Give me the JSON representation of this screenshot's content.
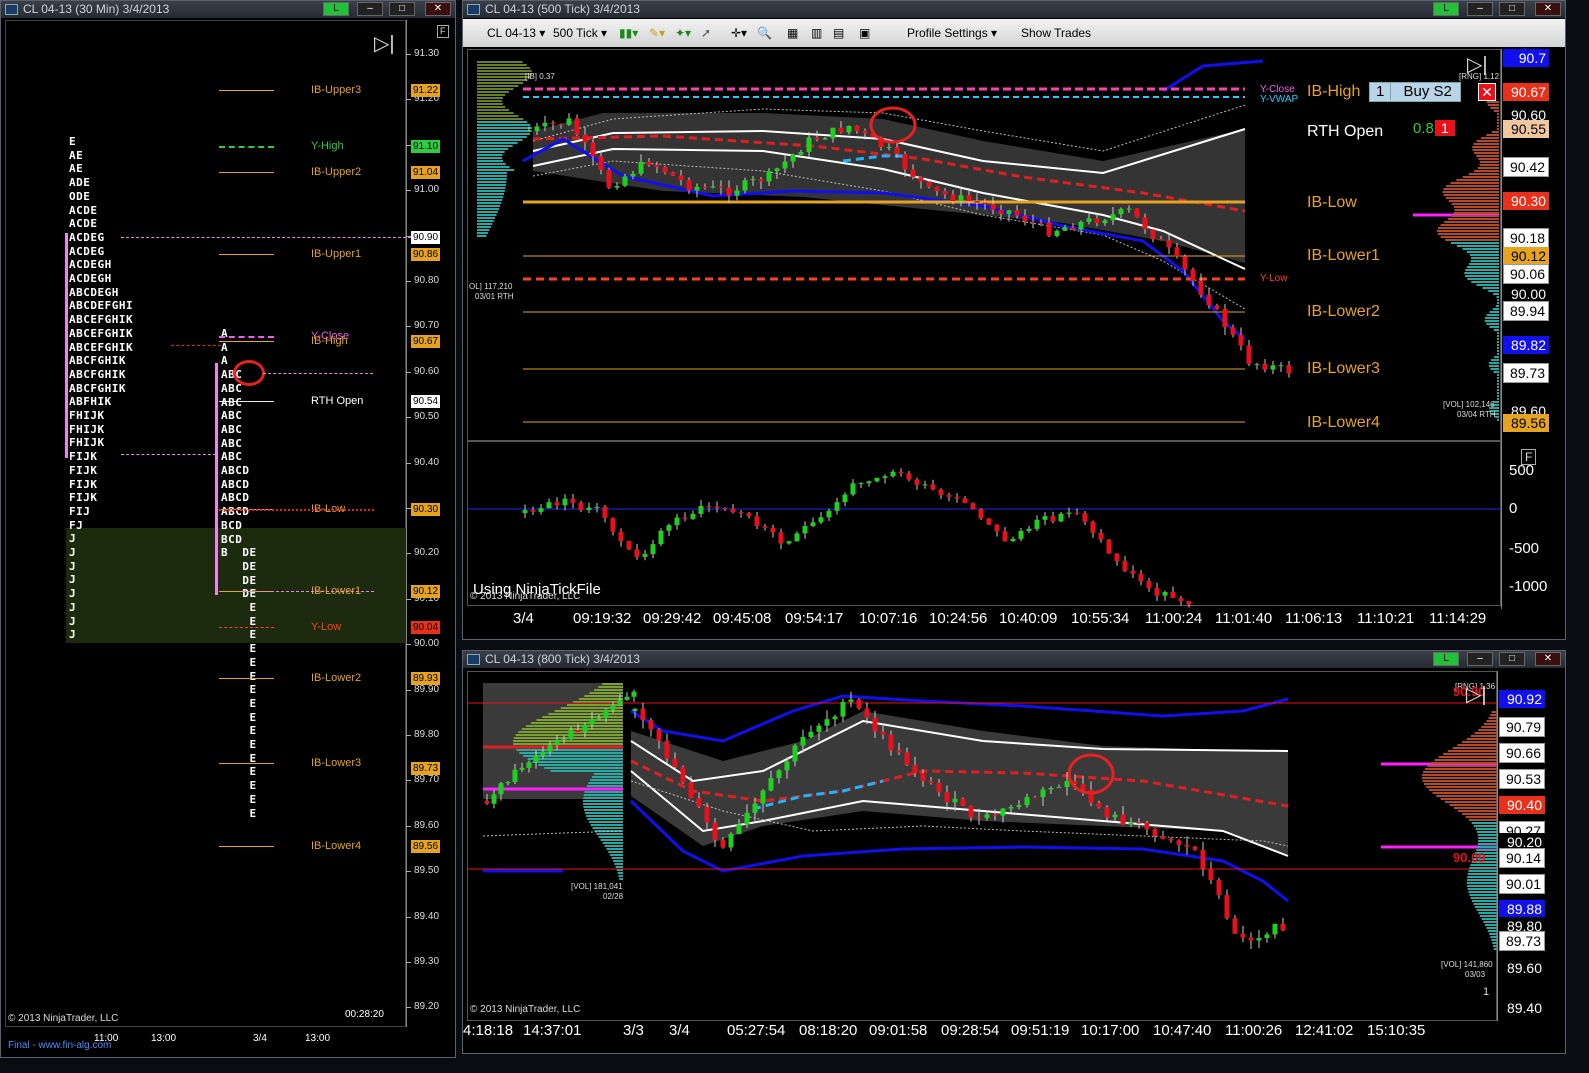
{
  "left": {
    "title": "CL 04-13 (30 Min)  3/4/2013",
    "prices": [
      "91.30",
      "91.20",
      "91.10",
      "91.00",
      "90.90",
      "90.80",
      "90.70",
      "90.60",
      "90.50",
      "90.40",
      "90.30",
      "90.20",
      "90.10",
      "90.00",
      "89.90",
      "89.80",
      "89.70",
      "89.60",
      "89.50",
      "89.40",
      "89.30",
      "89.20"
    ],
    "tags": [
      {
        "label": "91.22",
        "color": "#e5a320"
      },
      {
        "label": "91.10",
        "color": "#2ecc40"
      },
      {
        "label": "91.04",
        "color": "#e5a320"
      },
      {
        "label": "90.90",
        "color": "#ffffff"
      },
      {
        "label": "90.86",
        "color": "#e5a320"
      },
      {
        "label": "90.67",
        "color": "#e5a320"
      },
      {
        "label": "90.54",
        "color": "#ffffff"
      },
      {
        "label": "90.30",
        "color": "#e5a320"
      },
      {
        "label": "90.12",
        "color": "#e5a320"
      },
      {
        "label": "90.04",
        "color": "#e8301a"
      },
      {
        "label": "89.93",
        "color": "#e5a320"
      },
      {
        "label": "89.73",
        "color": "#e5a320"
      },
      {
        "label": "89.56",
        "color": "#e5a320"
      }
    ],
    "levels": [
      "IB-Upper3",
      "Y-High",
      "IB-Upper2",
      "IB-Upper1",
      "Y-Close",
      "IB-High",
      "RTH Open",
      "IB-Low",
      "IB-Lower1",
      "Y-Low",
      "IB-Lower2",
      "IB-Lower3",
      "IB-Lower4"
    ],
    "profile1": [
      "E",
      "AE",
      "AE",
      "ADE",
      "ODE",
      "ACDE",
      "ACDE",
      "ACDEG",
      "ACDEG",
      "ACDEGH",
      "ACDEGH",
      "ABCDEGH",
      "ABCDEFGHI",
      "ABCEFGHIK",
      "ABCEFGHIK",
      "ABCEFGHIK",
      "ABCFGHIK",
      "ABCFGHIK",
      "ABCFGHIK",
      "ABFHIK",
      "FHIJK",
      "FHIJK",
      "FHIJK",
      "FIJK",
      "FIJK",
      "FIJK",
      "FIJK",
      "FIJ",
      "FJ",
      "J",
      "J",
      "J",
      "J",
      "J",
      "J",
      "J",
      "J"
    ],
    "profile2": [
      "A",
      "A",
      "A",
      "ABC",
      "ABC",
      "ABC",
      "ABC",
      "ABC",
      "ABC",
      "ABC",
      "ABCD",
      "ABCD",
      "ABCD",
      "ABCD",
      "BCD",
      "BCD",
      "B  DE",
      "   DE",
      "   DE",
      "   DE",
      "    E",
      "    E",
      "    E",
      "    E",
      "    E",
      "    E",
      "    E",
      "    E",
      "    E",
      "    E",
      "    E",
      "    E",
      "    E",
      "    E",
      "    E",
      "    E"
    ],
    "time_labels": [
      "11:00",
      "13:00",
      "3/4",
      "13:00"
    ],
    "clock": "00:28:20",
    "copyright": "© 2013 NinjaTrader, LLC",
    "footer": "Final - www.fin-alg.com"
  },
  "top": {
    "title": "CL 04-13 (500 Tick)  3/4/2013",
    "toolbar": {
      "instrument": "CL 04-13",
      "period": "500 Tick",
      "profile": "Profile Settings",
      "show_trades": "Show Trades"
    },
    "ib_label": "[IB] 0.37",
    "vol_left": "OL] 117,210",
    "vol_left_date": "03/01 RTH",
    "vol_right": "[VOL] 102,146",
    "vol_right_date": "03/04 RTH",
    "levels": [
      "IB-High",
      "RTH Open",
      "IB-Low",
      "IB-Lower1",
      "IB-Lower2",
      "IB-Lower3",
      "IB-Lower4"
    ],
    "y_close": "Y-Close",
    "y_vwap": "Y-VWAP",
    "y_low": "Y-Low",
    "rth_value": "0.82",
    "rth_badge": "1",
    "order_qty": "1",
    "order_label": "Buy S2",
    "price_tags": [
      {
        "label": "90.7",
        "color": "#1010ee",
        "fg": "#fff"
      },
      {
        "label": "90.67",
        "color": "#e8301a",
        "fg": "#fff"
      },
      {
        "label": "90.60",
        "color": "#000",
        "fg": "#fff"
      },
      {
        "label": "90.55",
        "color": "#f0c8a0",
        "fg": "#000"
      },
      {
        "label": "90.42",
        "color": "#fff",
        "fg": "#000"
      },
      {
        "label": "90.30",
        "color": "#e8301a",
        "fg": "#fff"
      },
      {
        "label": "90.18",
        "color": "#fff",
        "fg": "#000"
      },
      {
        "label": "90.12",
        "color": "#e5a320",
        "fg": "#000"
      },
      {
        "label": "90.06",
        "color": "#fff",
        "fg": "#000"
      },
      {
        "label": "90.00",
        "color": "#000",
        "fg": "#fff"
      },
      {
        "label": "89.94",
        "color": "#fff",
        "fg": "#000"
      },
      {
        "label": "89.82",
        "color": "#1010ee",
        "fg": "#fff"
      },
      {
        "label": "89.73",
        "color": "#fff",
        "fg": "#000"
      },
      {
        "label": "89.60",
        "color": "#000",
        "fg": "#fff"
      },
      {
        "label": "89.56",
        "color": "#e5a320",
        "fg": "#000"
      }
    ],
    "rng_label": "[RNG] 1.12",
    "osc_labels": [
      "500",
      "0",
      "-500",
      "-1000"
    ],
    "note": "Using NinjaTickFile",
    "copyright": "© 2013 NinjaTrader, LLC",
    "time_labels": [
      "3/4",
      "09:19:32",
      "09:29:42",
      "09:45:08",
      "09:54:17",
      "10:07:16",
      "10:24:56",
      "10:40:09",
      "10:55:34",
      "11:00:24",
      "11:01:40",
      "11:06:13",
      "11:10:21",
      "11:14:29"
    ]
  },
  "bottom": {
    "title": "CL 04-13 (800 Tick)  3/4/2013",
    "vol_left": "[VOL] 181,041",
    "vol_left_date": "02/28",
    "vol_right": "[VOL] 141,860",
    "vol_right_date": "03/03",
    "rng_label": "[RNG] 1.36",
    "level_red": "90.09",
    "level_red_top": "90.90",
    "price_tags": [
      {
        "label": "90.92",
        "color": "#1010ee",
        "fg": "#fff"
      },
      {
        "label": "90.79",
        "color": "#fff",
        "fg": "#000"
      },
      {
        "label": "90.66",
        "color": "#fff",
        "fg": "#000"
      },
      {
        "label": "90.53",
        "color": "#fff",
        "fg": "#000"
      },
      {
        "label": "90.40",
        "color": "#e8301a",
        "fg": "#fff"
      },
      {
        "label": "90.27",
        "color": "#fff",
        "fg": "#000"
      },
      {
        "label": "90.20",
        "color": "#000",
        "fg": "#fff"
      },
      {
        "label": "90.14",
        "color": "#fff",
        "fg": "#000"
      },
      {
        "label": "90.01",
        "color": "#fff",
        "fg": "#000"
      },
      {
        "label": "89.88",
        "color": "#1010ee",
        "fg": "#fff"
      },
      {
        "label": "89.80",
        "color": "#000",
        "fg": "#fff"
      },
      {
        "label": "89.73",
        "color": "#fff",
        "fg": "#000"
      },
      {
        "label": "89.60",
        "color": "#000",
        "fg": "#fff"
      },
      {
        "label": "89.40",
        "color": "#000",
        "fg": "#fff"
      }
    ],
    "one": "1",
    "copyright": "© 2013 NinjaTrader, LLC",
    "time_labels": [
      "4:18:18",
      "14:37:01",
      "3/3",
      "3/4",
      "05:27:54",
      "08:18:20",
      "09:01:58",
      "09:28:54",
      "09:51:19",
      "10:17:00",
      "10:47:40",
      "11:00:26",
      "12:41:02",
      "15:10:35"
    ]
  }
}
